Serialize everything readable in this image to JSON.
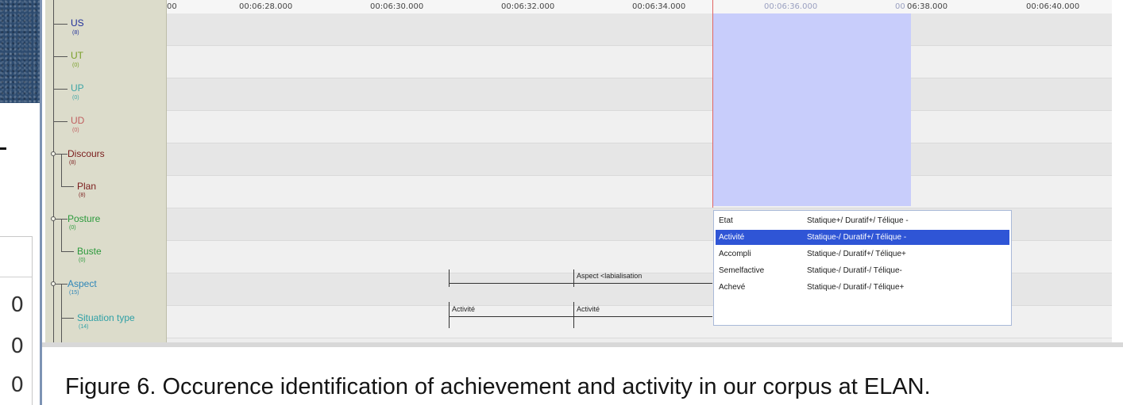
{
  "timeline": {
    "ticks": [
      "00",
      "00:06:28.000",
      "00:06:30.000",
      "00:06:32.000",
      "00:06:34.000",
      "00:06:36.000",
      "00",
      "06:38.000",
      "00:06:40.000"
    ]
  },
  "tiers": [
    {
      "label": "US",
      "count": "(8)",
      "color": "#1f2f9a"
    },
    {
      "label": "UT",
      "count": "(0)",
      "color": "#7aa02a"
    },
    {
      "label": "UP",
      "count": "(0)",
      "color": "#3fa6a6"
    },
    {
      "label": "UD",
      "count": "(0)",
      "color": "#c06060"
    },
    {
      "label": "Discours",
      "count": "(8)",
      "color": "#7a1c1c"
    },
    {
      "label": "Plan",
      "count": "(8)",
      "color": "#7a1c1c"
    },
    {
      "label": "Posture",
      "count": "(0)",
      "color": "#2c9a3c"
    },
    {
      "label": "Buste",
      "count": "(0)",
      "color": "#2c9a3c"
    },
    {
      "label": "Aspect",
      "count": "(15)",
      "color": "#2f86b8"
    },
    {
      "label": "Situation type",
      "count": "(14)",
      "color": "#2fa0a6"
    }
  ],
  "annotations": {
    "aspect": "Aspect <labialisation",
    "situation_1": "Activité",
    "situation_2": "Activité"
  },
  "popup": {
    "items": [
      {
        "name": "Etat",
        "desc": "Statique+/ Duratif+/ Télique -"
      },
      {
        "name": "Activité",
        "desc": "Statique-/ Duratif+/ Télique -"
      },
      {
        "name": "Accompli",
        "desc": "Statique-/ Duratif+/ Télique+"
      },
      {
        "name": "Semelfactive",
        "desc": "Statique-/ Duratif-/ Télique-"
      },
      {
        "name": "Achevé",
        "desc": "Statique-/ Duratif-/ Télique+"
      }
    ],
    "selected_index": 1
  },
  "background": {
    "zeros": [
      "0",
      "0",
      "0"
    ]
  },
  "caption": "Figure 6. Occurence identification of achievement and activity in our corpus at ELAN."
}
